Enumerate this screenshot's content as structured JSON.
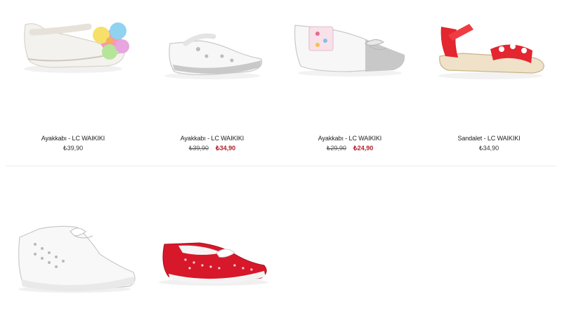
{
  "products": [
    {
      "name": "Ayakkabı - LC WAIKIKI",
      "price": "₺39,90",
      "old_price": null,
      "sale_price": null,
      "image_icon": "white-ballerina-flower-icon"
    },
    {
      "name": "Ayakkabı - LC WAIKIKI",
      "price": null,
      "old_price": "₺39,90",
      "sale_price": "₺34,90",
      "image_icon": "white-silver-strap-shoe-icon"
    },
    {
      "name": "Ayakkabı - LC WAIKIKI",
      "price": null,
      "old_price": "₺29,90",
      "sale_price": "₺24,90",
      "image_icon": "white-silver-bow-flat-icon"
    },
    {
      "name": "Sandalet - LC WAIKIKI",
      "price": "₺34,90",
      "old_price": null,
      "sale_price": null,
      "image_icon": "red-sandal-icon"
    },
    {
      "name": null,
      "price": null,
      "old_price": null,
      "sale_price": null,
      "image_icon": "white-sneaker-icon"
    },
    {
      "name": null,
      "price": null,
      "old_price": null,
      "sale_price": null,
      "image_icon": "red-dotted-slipon-icon"
    }
  ],
  "colors": {
    "sale": "#b3202a",
    "divider": "#ececec"
  }
}
